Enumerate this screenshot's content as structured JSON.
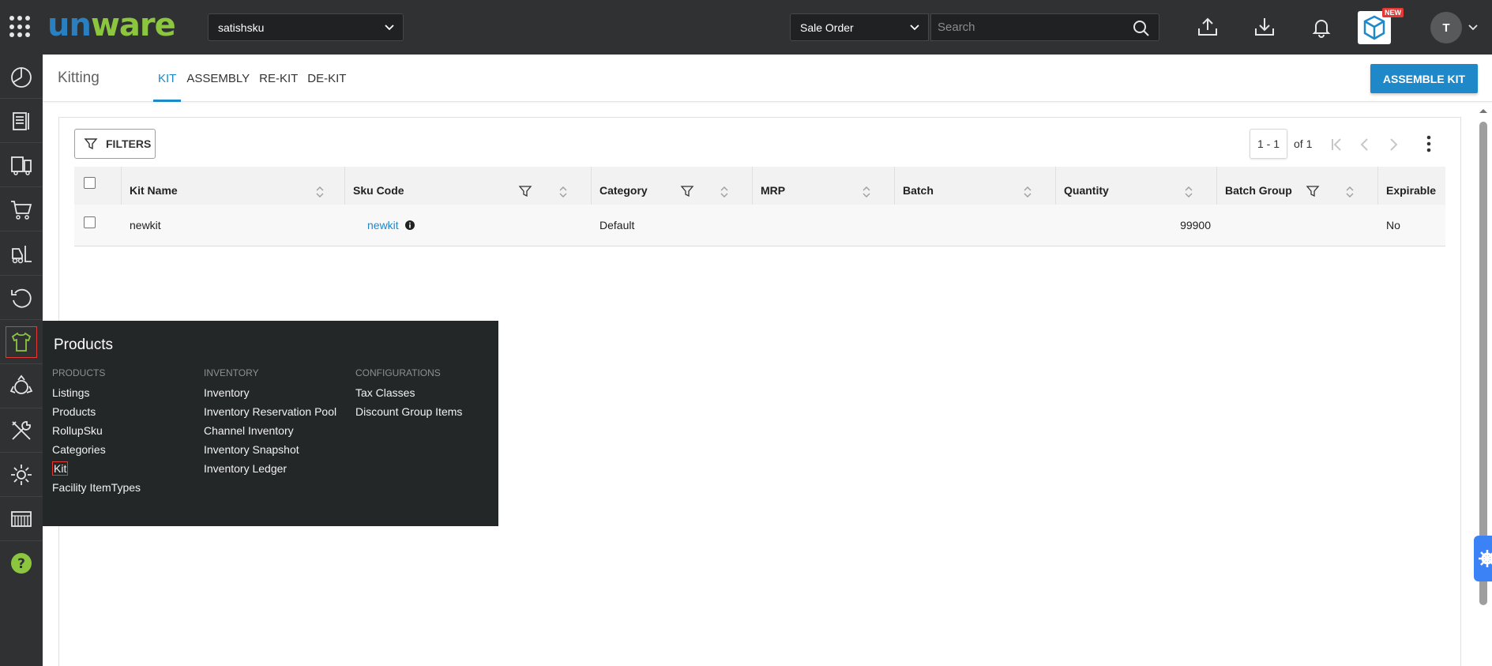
{
  "topbar": {
    "logo": "unware",
    "tenant": "satishsku",
    "search_type": "Sale Order",
    "search_placeholder": "Search",
    "new_badge": "NEW",
    "avatar_initial": "T"
  },
  "sidebar": {
    "items": [
      {
        "name": "dashboard",
        "icon": "pie-chart-icon"
      },
      {
        "name": "orders",
        "icon": "document-icon"
      },
      {
        "name": "shipping",
        "icon": "truck-icon"
      },
      {
        "name": "purchase",
        "icon": "cart-icon"
      },
      {
        "name": "warehouse",
        "icon": "forklift-icon"
      },
      {
        "name": "returns",
        "icon": "refresh-icon"
      },
      {
        "name": "products",
        "icon": "tshirt-icon",
        "active": true
      },
      {
        "name": "recycle",
        "icon": "recycle-icon"
      },
      {
        "name": "tools",
        "icon": "tools-icon"
      },
      {
        "name": "settings",
        "icon": "gear-icon"
      },
      {
        "name": "reports",
        "icon": "keyboard-icon"
      },
      {
        "name": "help",
        "icon": "help-icon"
      }
    ]
  },
  "header": {
    "title": "Kitting",
    "tabs": [
      {
        "label": "KIT",
        "active": true
      },
      {
        "label": "ASSEMBLY"
      },
      {
        "label": "RE-KIT"
      },
      {
        "label": "DE-KIT"
      }
    ],
    "action_label": "ASSEMBLE KIT"
  },
  "toolbar": {
    "filters_label": "FILTERS",
    "pager_range": "1 - 1",
    "pager_of": "of 1"
  },
  "table": {
    "columns": [
      "Kit Name",
      "Sku Code",
      "Category",
      "MRP",
      "Batch",
      "Quantity",
      "Batch Group",
      "Expirable"
    ],
    "rows": [
      {
        "kit_name": "newkit",
        "sku_code": "newkit",
        "category": "Default",
        "mrp": "",
        "batch": "",
        "quantity": "99900",
        "batch_group": "",
        "expirable": "No"
      }
    ]
  },
  "products_menu": {
    "title": "Products",
    "columns": [
      {
        "heading": "PRODUCTS",
        "items": [
          "Listings",
          "Products",
          "RollupSku",
          "Categories",
          "Kit",
          "Facility ItemTypes"
        ]
      },
      {
        "heading": "INVENTORY",
        "items": [
          "Inventory",
          "Inventory Reservation Pool",
          "Channel Inventory",
          "Inventory Snapshot",
          "Inventory Ledger"
        ]
      },
      {
        "heading": "CONFIGURATIONS",
        "items": [
          "Tax Classes",
          "Discount Group Items"
        ]
      }
    ],
    "highlighted_item": "Kit"
  },
  "colors": {
    "topbar_bg": "#2f3133",
    "accent_blue": "#1e88c8",
    "brand_green": "#8cc63f",
    "active_highlight": "#e53935",
    "menu_bg": "#242727"
  }
}
